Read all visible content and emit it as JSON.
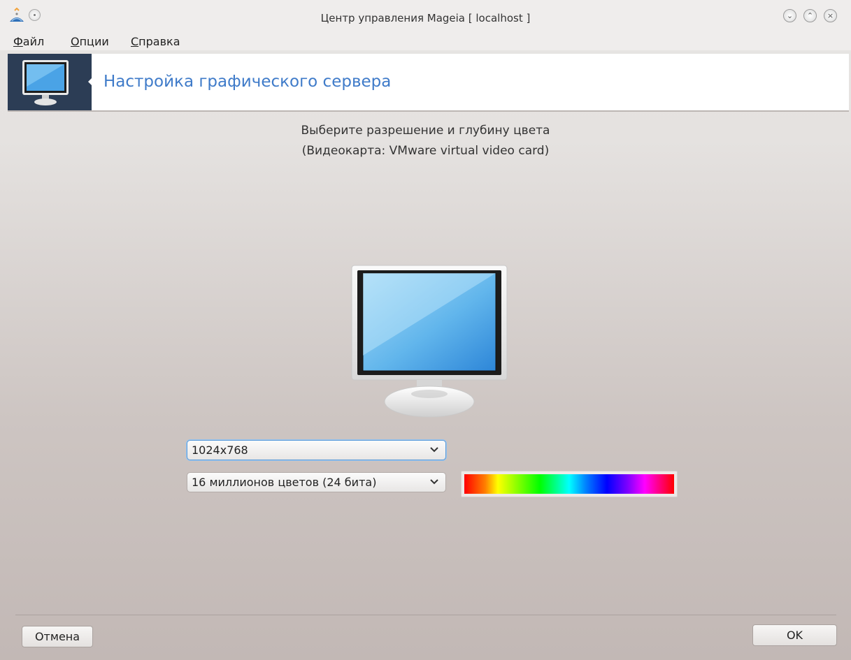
{
  "window": {
    "title": "Центр управления Mageia  [ localhost ]",
    "pin_icon": "pin-icon",
    "app_icon": "mageia-logo-icon",
    "buttons": {
      "minimize_icon": "chevron-down-icon",
      "maximize_icon": "chevron-up-icon",
      "close_icon": "close-icon"
    }
  },
  "menu": {
    "items": [
      {
        "label": "Файл",
        "mnemonic": "Ф",
        "rest": "айл"
      },
      {
        "label": "Опции",
        "mnemonic": "О",
        "rest": "пции"
      },
      {
        "label": "Справка",
        "mnemonic": "С",
        "rest": "правка"
      }
    ]
  },
  "header": {
    "title": "Настройка графического сервера",
    "icon": "monitor-icon",
    "accent_color": "#3f7bc9",
    "icon_bg_color": "#2c3d55"
  },
  "main": {
    "prompt_line1": "Выберите разрешение и глубину цвета",
    "prompt_line2": "(Видеокарта: VMware virtual video card)",
    "preview_icon": "monitor-preview-icon",
    "resolution": {
      "selected": "1024x768"
    },
    "color_depth": {
      "selected": "16 миллионов цветов (24 бита)"
    },
    "spectrum_icon": "color-spectrum-bar"
  },
  "footer": {
    "cancel_label": "Отмена",
    "ok_label": "OK"
  }
}
